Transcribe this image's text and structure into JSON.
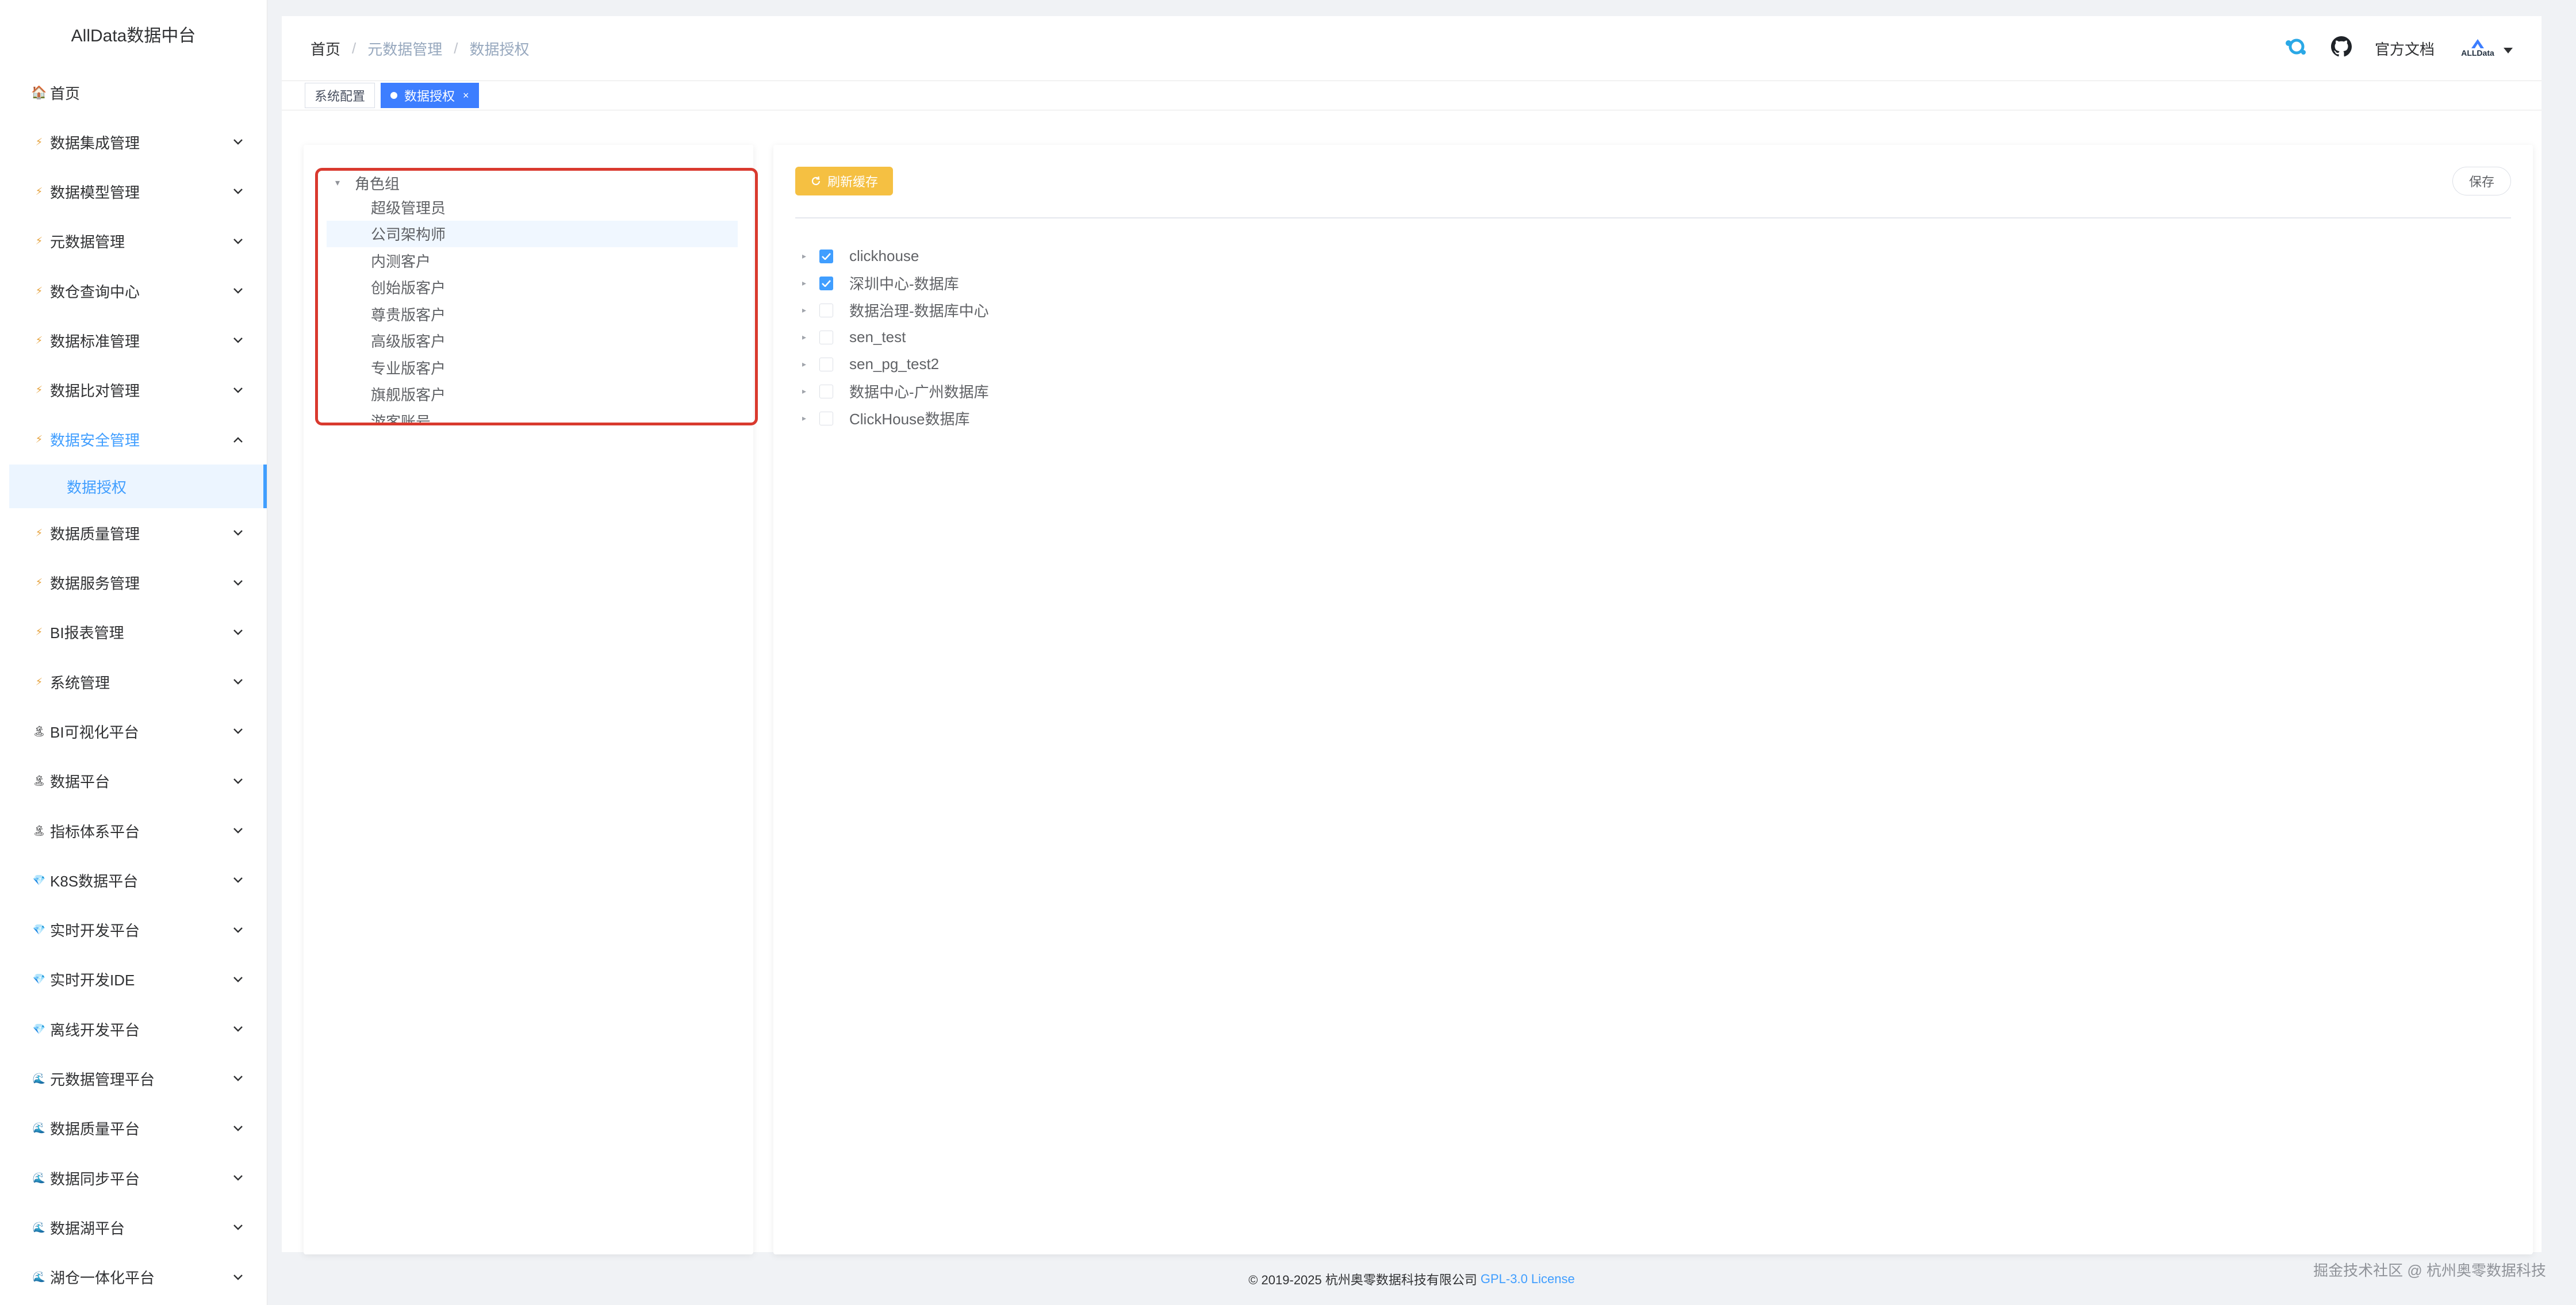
{
  "app": {
    "title": "AllData数据中台"
  },
  "sidebar": {
    "home": {
      "label": "首页",
      "icon": "home-icon"
    },
    "items": [
      {
        "label": "数据集成管理",
        "icon": "lightning-icon"
      },
      {
        "label": "数据模型管理",
        "icon": "lightning-icon"
      },
      {
        "label": "元数据管理",
        "icon": "lightning-icon"
      },
      {
        "label": "数仓查询中心",
        "icon": "lightning-icon"
      },
      {
        "label": "数据标准管理",
        "icon": "lightning-icon"
      },
      {
        "label": "数据比对管理",
        "icon": "lightning-icon"
      },
      {
        "label": "数据安全管理",
        "icon": "lightning-icon",
        "open": true
      },
      {
        "label": "数据质量管理",
        "icon": "lightning-icon"
      },
      {
        "label": "数据服务管理",
        "icon": "lightning-icon"
      },
      {
        "label": "BI报表管理",
        "icon": "lightning-icon"
      },
      {
        "label": "系统管理",
        "icon": "lightning-icon"
      },
      {
        "label": "BI可视化平台",
        "icon": "palm-icon"
      },
      {
        "label": "数据平台",
        "icon": "palm-icon"
      },
      {
        "label": "指标体系平台",
        "icon": "palm-icon"
      },
      {
        "label": "K8S数据平台",
        "icon": "gem-icon"
      },
      {
        "label": "实时开发平台",
        "icon": "gem-icon"
      },
      {
        "label": "实时开发IDE",
        "icon": "gem-icon"
      },
      {
        "label": "离线开发平台",
        "icon": "gem-icon"
      },
      {
        "label": "元数据管理平台",
        "icon": "wave-icon"
      },
      {
        "label": "数据质量平台",
        "icon": "wave-icon"
      },
      {
        "label": "数据同步平台",
        "icon": "wave-icon"
      },
      {
        "label": "数据湖平台",
        "icon": "wave-icon"
      },
      {
        "label": "湖仓一体化平台",
        "icon": "wave-icon"
      }
    ],
    "active_sub": "数据授权"
  },
  "navbar": {
    "breadcrumb": [
      "首页",
      "元数据管理",
      "数据授权"
    ],
    "doc_label": "官方文档",
    "avatar_text": "ALLData"
  },
  "tags": {
    "items": [
      {
        "label": "系统配置",
        "active": false
      },
      {
        "label": "数据授权",
        "active": true
      }
    ],
    "close": "×"
  },
  "roles": {
    "root": "角色组",
    "items": [
      "超级管理员",
      "公司架构师",
      "内测客户",
      "创始版客户",
      "尊贵版客户",
      "高级版客户",
      "专业版客户",
      "旗舰版客户",
      "游客账号"
    ],
    "selected_index": 1
  },
  "toolbar": {
    "refresh_label": "刷新缓存",
    "save_label": "保存"
  },
  "databases": [
    {
      "name": "clickhouse",
      "checked": true
    },
    {
      "name": "深圳中心-数据库",
      "checked": true
    },
    {
      "name": "数据治理-数据库中心",
      "checked": false
    },
    {
      "name": "sen_test",
      "checked": false
    },
    {
      "name": "sen_pg_test2",
      "checked": false
    },
    {
      "name": "数据中心-广州数据库",
      "checked": false
    },
    {
      "name": "ClickHouse数据库",
      "checked": false
    }
  ],
  "footer": {
    "copyright": "© 2019-2025 杭州奥零数据科技有限公司",
    "license": "GPL-3.0 License"
  },
  "watermark": "掘金技术社区 @ 杭州奥零数据科技",
  "colors": {
    "accent": "#409eff",
    "highlight_box": "#d9392e",
    "refresh_button": "#f5c042",
    "active_tag": "#3d7eff"
  }
}
